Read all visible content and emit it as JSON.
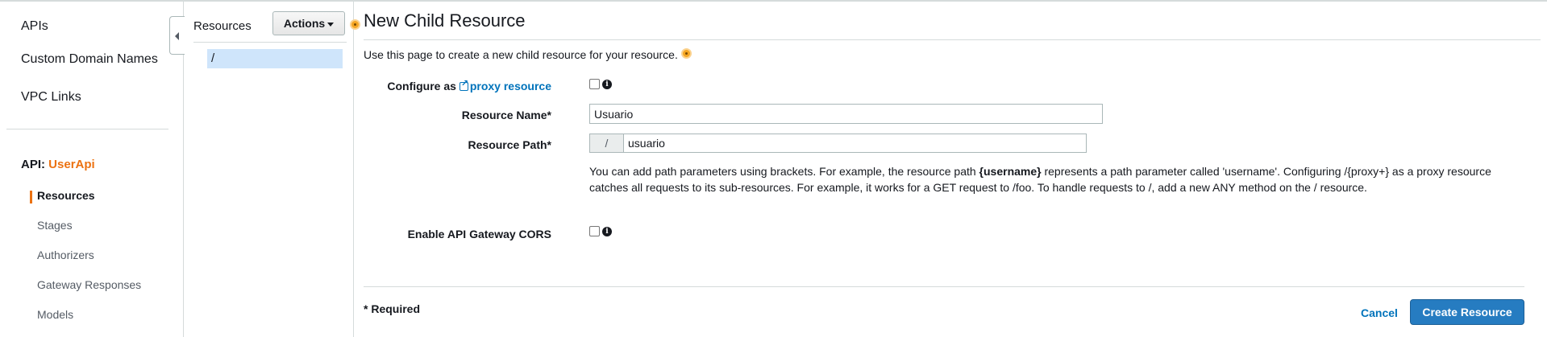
{
  "nav": {
    "items": [
      {
        "label": "APIs"
      },
      {
        "label": "Custom Domain Names"
      },
      {
        "label": "VPC Links"
      }
    ],
    "api_prefix": "API:",
    "api_name": "UserApi",
    "sub_items": [
      {
        "label": "Resources",
        "active": true
      },
      {
        "label": "Stages"
      },
      {
        "label": "Authorizers"
      },
      {
        "label": "Gateway Responses"
      },
      {
        "label": "Models"
      }
    ]
  },
  "resources_panel": {
    "title": "Resources",
    "actions_label": "Actions",
    "tree": [
      {
        "label": "/"
      }
    ]
  },
  "main": {
    "title": "New Child Resource",
    "description": "Use this page to create a new child resource for your resource.",
    "proxy": {
      "label_prefix": "Configure as",
      "link_text": "proxy resource",
      "checked": false
    },
    "resource_name": {
      "label": "Resource Name*",
      "value": "Usuario"
    },
    "resource_path": {
      "label": "Resource Path*",
      "prefix": "/",
      "value": "usuario"
    },
    "help": {
      "before": "You can add path parameters using brackets. For example, the resource path ",
      "bold": "{username}",
      "after": " represents a path parameter called 'username'. Configuring /{proxy+} as a proxy resource catches all requests to its sub-resources. For example, it works for a GET request to /foo. To handle requests to /, add a new ANY method on the / resource."
    },
    "cors": {
      "label": "Enable API Gateway CORS",
      "checked": false
    },
    "required_note": "* Required",
    "cancel_label": "Cancel",
    "create_label": "Create Resource"
  },
  "colors": {
    "accent_orange": "#ec7211",
    "link_blue": "#0073bb",
    "primary_button": "#267cc1",
    "selection_bg": "#cfe5fb"
  }
}
